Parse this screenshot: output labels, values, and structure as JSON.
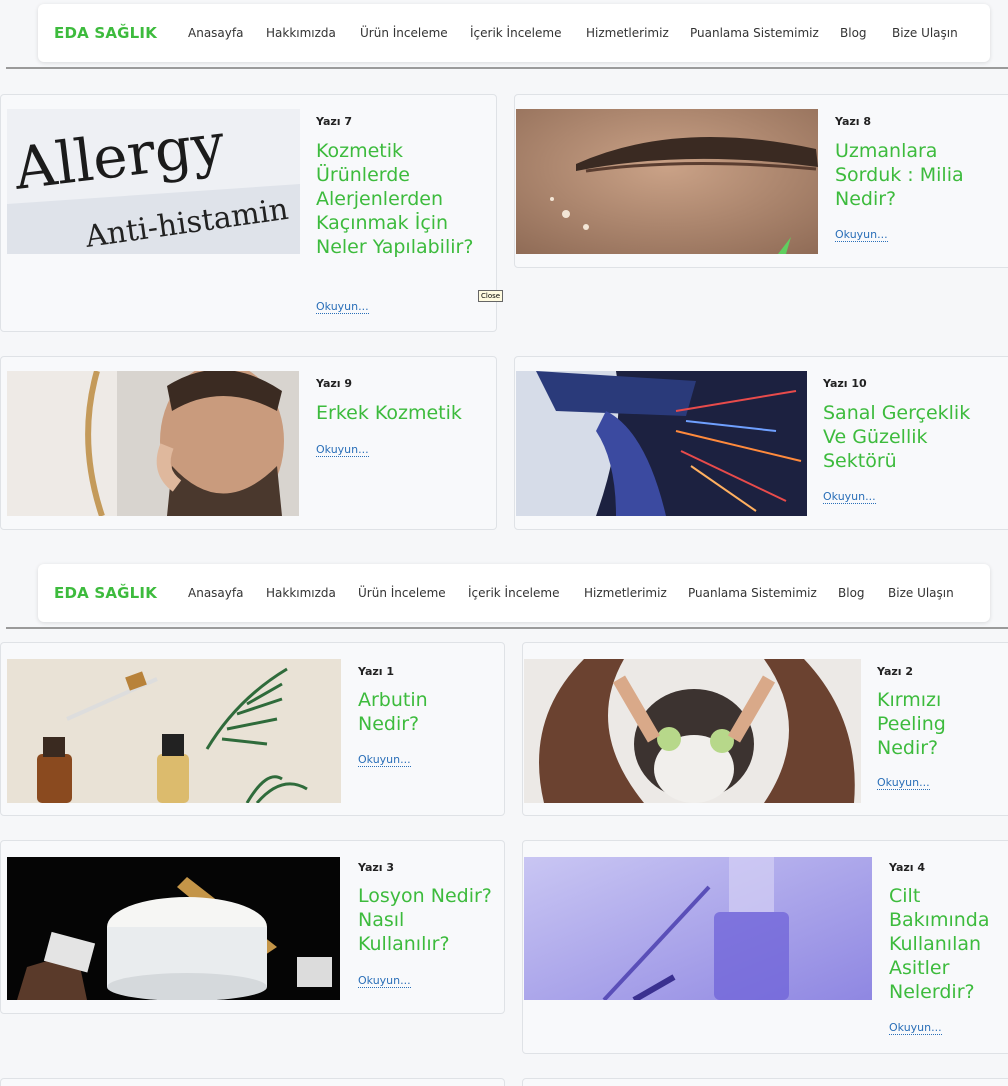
{
  "brand": "EDA SAĞLIK",
  "nav": [
    "Anasayfa",
    "Hakkımızda",
    "Ürün İnceleme",
    "İçerik İnceleme",
    "Hizmetlerimiz",
    "Puanlama Sistemimiz",
    "Blog",
    "Bize Ulaşın"
  ],
  "read_more": "Okuyun...",
  "tooltip": "Close",
  "posts": {
    "p7": {
      "tag": "Yazı 7",
      "title": "Kozmetik Ürünlerde Alerjenlerden Kaçınmak İçin Neler Yapılabilir?",
      "img_text1": "Allergy",
      "img_text2": "Anti-histamin"
    },
    "p8": {
      "tag": "Yazı 8",
      "title": "Uzmanlara Sorduk : Milia Nedir?"
    },
    "p9": {
      "tag": "Yazı 9",
      "title": "Erkek Kozmetik"
    },
    "p10": {
      "tag": "Yazı 10",
      "title": "Sanal Gerçeklik Ve Güzellik Sektörü"
    },
    "p1": {
      "tag": "Yazı 1",
      "title": "Arbutin Nedir?"
    },
    "p2": {
      "tag": "Yazı 2",
      "title": "Kırmızı Peeling Nedir?"
    },
    "p3": {
      "tag": "Yazı 3",
      "title": "Losyon Nedir? Nasıl Kullanılır?"
    },
    "p4": {
      "tag": "Yazı 4",
      "title": "Cilt Bakımında Kullanılan Asitler Nelerdir?"
    }
  },
  "colors": {
    "brand_green": "#3dbb3d",
    "link_blue": "#2a6fb8"
  }
}
